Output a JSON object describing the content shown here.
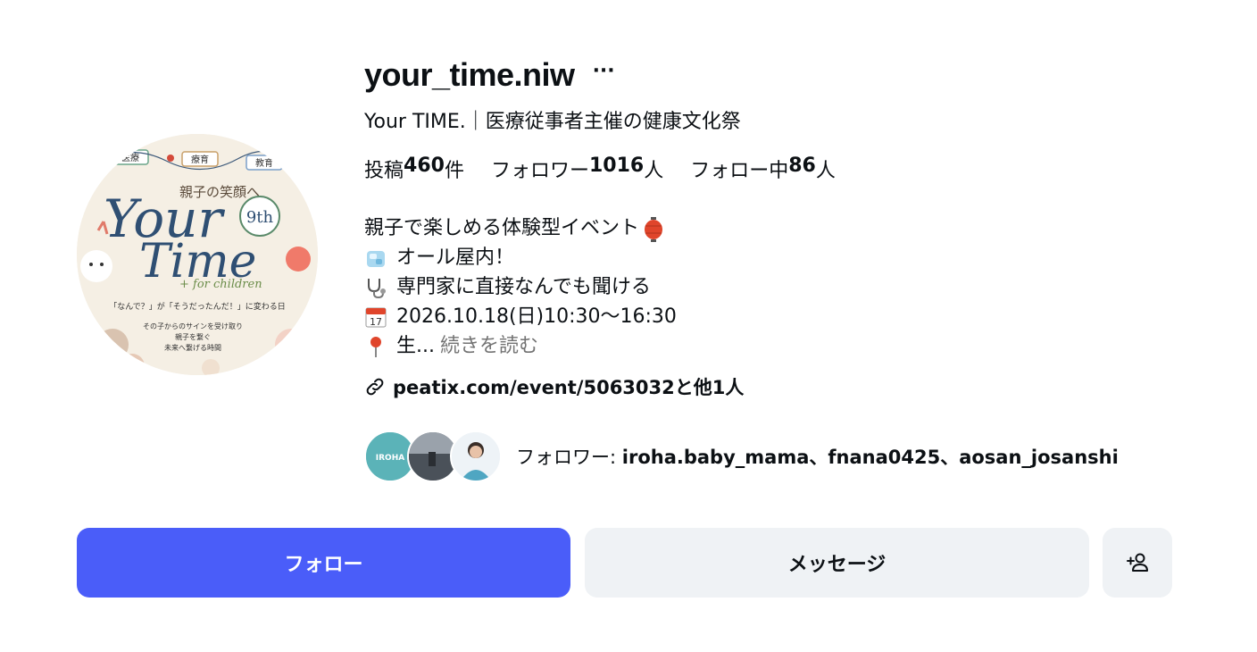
{
  "profile": {
    "username": "your_time.niw",
    "more_icon_label": "···",
    "full_name": "Your TIME.｜医療従事者主催の健康文化祭",
    "stats": [
      {
        "prefix": "投稿",
        "value": "460",
        "suffix": "件"
      },
      {
        "prefix": "フォロワー",
        "value": "1016",
        "suffix": "人"
      },
      {
        "prefix": "フォロー中",
        "value": "86",
        "suffix": "人"
      }
    ],
    "bio": {
      "line1": "親子で楽しめる体験型イベント",
      "line2": "オール屋内！",
      "line3": "専門家に直接なんでも聞ける",
      "line4": "2026.10.18(日)10:30〜16:30",
      "line5": "生...",
      "read_more": "続きを読む",
      "icons": [
        "lantern-emoji",
        "ice-cube-emoji",
        "stethoscope-emoji",
        "calendar-emoji",
        "round-pushpin-emoji"
      ],
      "calendar_day": "17"
    },
    "link": "peatix.com/event/5063032と他1人",
    "followed_by": {
      "prefix": "フォロワー: ",
      "names": "iroha.baby_mama、fnana0425、aosan_josanshi"
    },
    "avatar_text": {
      "tags": [
        "医療",
        "療育",
        "教育"
      ],
      "tagline": "親子の笑顔へ",
      "word1": "Your",
      "word2": "Time",
      "badge": "9th",
      "sub": "+ for children",
      "caption": "「なんで？」が「そうだったんだ！」に変わる日",
      "lines": [
        "その子からのサインを受け取り",
        "親子を繋ぐ",
        "未来へ繋げる時間"
      ]
    },
    "mini_avatar_text": "IROHA"
  },
  "buttons": {
    "follow": "フォロー",
    "message": "メッセージ"
  },
  "colors": {
    "follow_bg": "#4a5df9",
    "secondary_bg": "#eff2f5",
    "muted_text": "#737373"
  }
}
